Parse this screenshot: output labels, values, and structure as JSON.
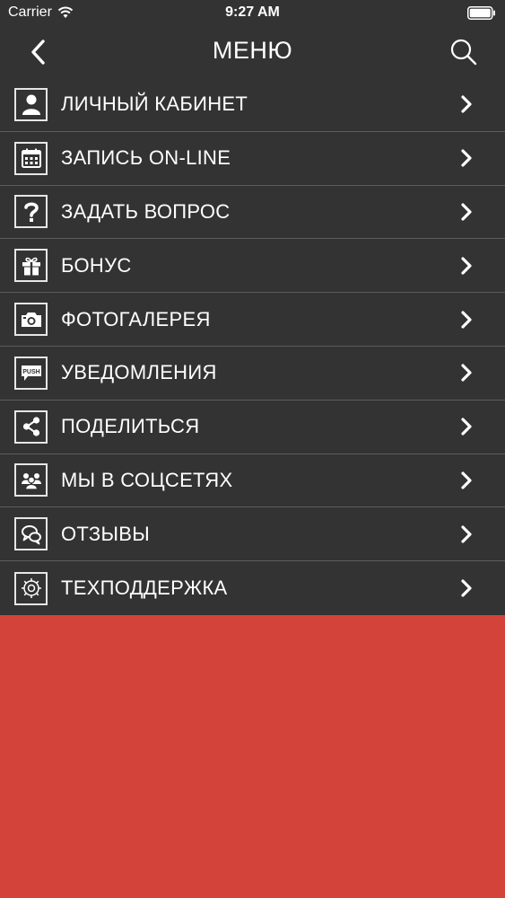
{
  "status_bar": {
    "carrier": "Carrier",
    "time": "9:27 AM"
  },
  "nav": {
    "title": "МЕНЮ",
    "back_icon": "chevron-left-icon",
    "search_icon": "search-icon"
  },
  "menu": {
    "items": [
      {
        "label": "ЛИЧНЫЙ КАБИНЕТ",
        "icon": "user-icon"
      },
      {
        "label": "ЗАПИСЬ ON-LINE",
        "icon": "calendar-icon"
      },
      {
        "label": "ЗАДАТЬ ВОПРОС",
        "icon": "question-icon"
      },
      {
        "label": "БОНУС",
        "icon": "gift-icon"
      },
      {
        "label": "ФОТОГАЛЕРЕЯ",
        "icon": "camera-icon"
      },
      {
        "label": "УВЕДОМЛЕНИЯ",
        "icon": "push-icon",
        "icon_text": "PUSH"
      },
      {
        "label": "ПОДЕЛИТЬСЯ",
        "icon": "share-icon"
      },
      {
        "label": "МЫ В СОЦСЕТЯХ",
        "icon": "group-icon"
      },
      {
        "label": "ОТЗЫВЫ",
        "icon": "chat-bubbles-icon"
      },
      {
        "label": "ТЕХПОДДЕРЖКА",
        "icon": "gear-icon"
      }
    ]
  },
  "colors": {
    "menu_background": "#333333",
    "divider": "#5c5c5c",
    "accent_red": "#d4433a",
    "text": "#ffffff"
  }
}
